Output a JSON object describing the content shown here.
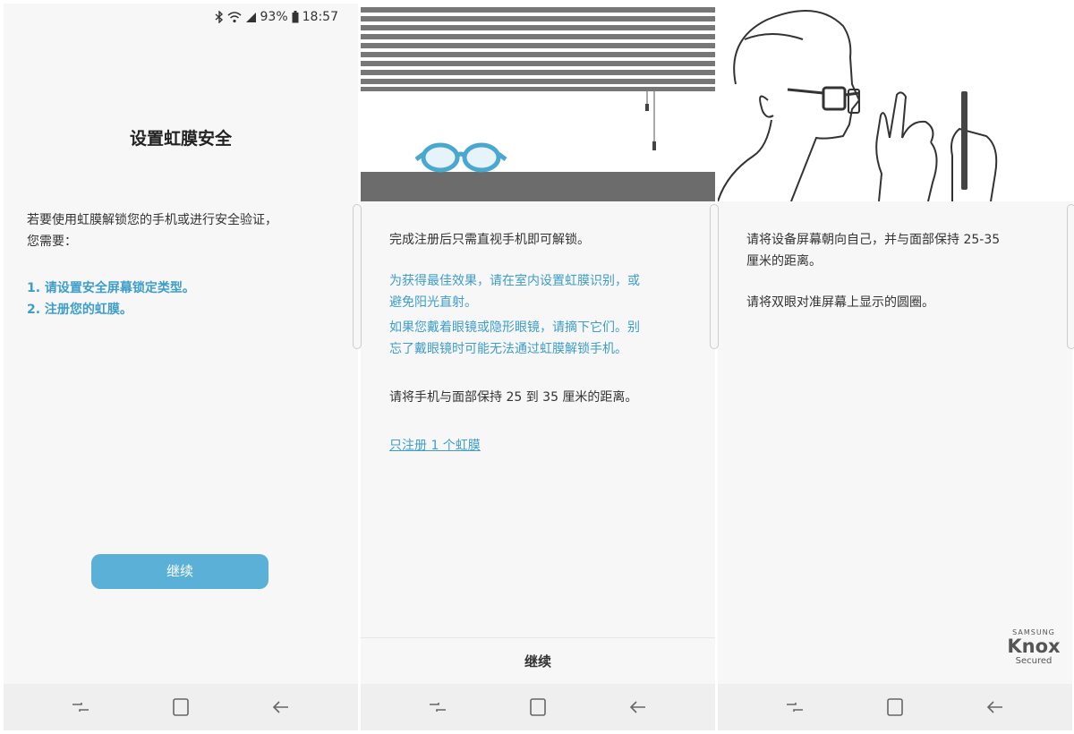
{
  "status": {
    "battery": "93%",
    "time": "18:57"
  },
  "screen1": {
    "title": "设置虹膜安全",
    "intro_line1": "若要使用虹膜解锁您的手机或进行安全验证，",
    "intro_line2": "您需要：",
    "step1": "1. 请设置安全屏幕锁定类型。",
    "step2": "2. 注册您的虹膜。",
    "continue_label": "继续"
  },
  "screen2": {
    "line1": "完成注册后只需直视手机即可解锁。",
    "tip1_line1": "为获得最佳效果，请在室内设置虹膜识别，或",
    "tip1_line2": "避免阳光直射。",
    "tip2_line1": "如果您戴着眼镜或隐形眼镜，请摘下它们。别",
    "tip2_line2": "忘了戴眼镜时可能无法通过虹膜解锁手机。",
    "distance": "请将手机与面部保持 25 到 35 厘米的距离。",
    "link": "只注册 1 个虹膜",
    "continue_label": "继续"
  },
  "screen3": {
    "line1a": "请将设备屏幕朝向自己，并与面部保持 25-35",
    "line1b": "厘米的距离。",
    "line2": "请将双眼对准屏幕上显示的圆圈。",
    "knox_brand": "SAMSUNG",
    "knox_name": "Knox",
    "knox_sub": "Secured"
  },
  "icons": {
    "recent": "recent-apps-icon",
    "home": "home-icon",
    "back": "back-icon",
    "bluetooth": "bluetooth-icon",
    "wifi": "wifi-icon",
    "signal": "signal-icon",
    "battery": "battery-icon"
  },
  "colors": {
    "accent": "#3e9ec9",
    "button": "#5ab0d6",
    "glasses": "#4aa8cf"
  }
}
